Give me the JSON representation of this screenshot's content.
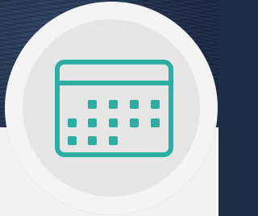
{
  "icon": {
    "name": "calendar-icon",
    "color": "#2bada3"
  },
  "colors": {
    "badge_outer": "#f4f4f4",
    "badge_inner": "#e5e5e5",
    "card": "#f2f2f2",
    "background": "#1c2d46"
  }
}
